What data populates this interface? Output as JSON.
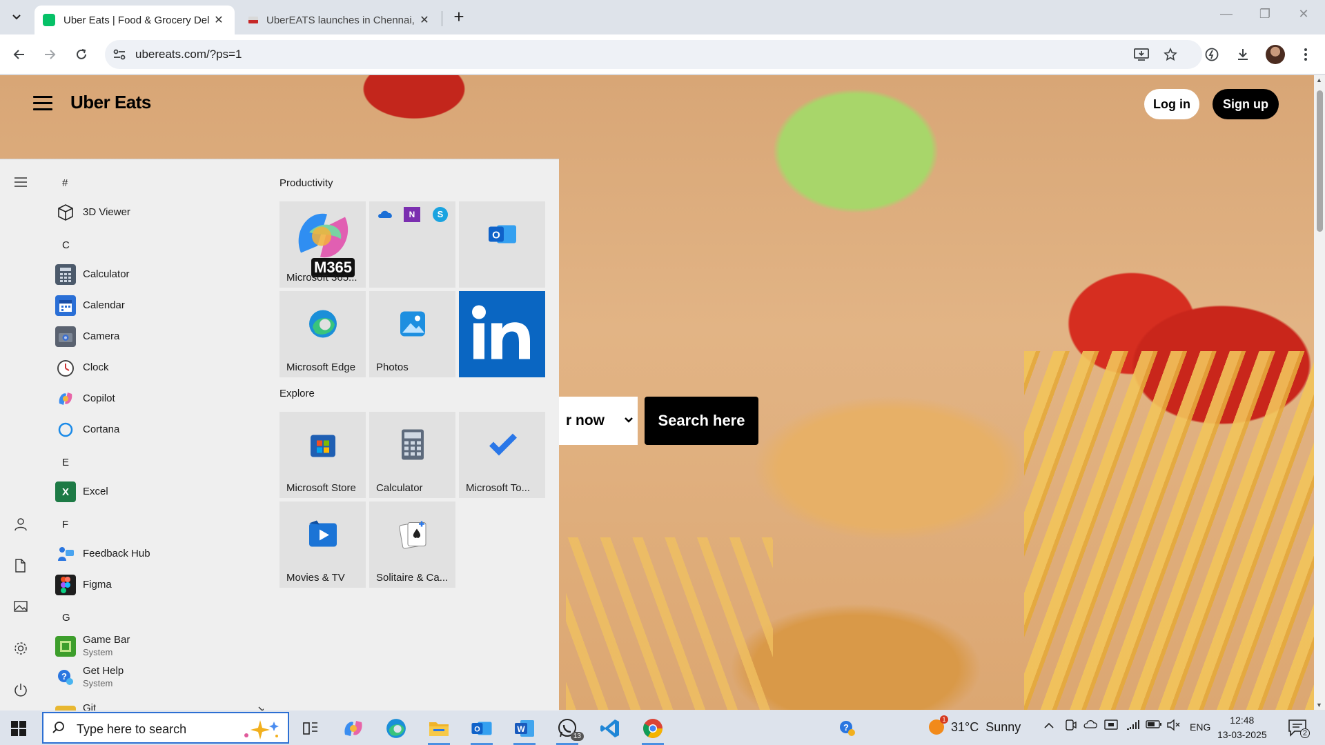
{
  "browser": {
    "tabs": [
      {
        "title": "Uber Eats | Food & Grocery Del",
        "active": true
      },
      {
        "title": "UberEATS launches in Chennai,",
        "active": false
      }
    ],
    "new_tab_label": "+",
    "url": "ubereats.com/?ps=1"
  },
  "site": {
    "logo": "Uber Eats",
    "login_label": "Log in",
    "signup_label": "Sign up",
    "deliver_label": "r now",
    "search_label": "Search here"
  },
  "start_menu": {
    "apps": [
      {
        "type": "letter",
        "text": "#"
      },
      {
        "type": "app",
        "name": "3D Viewer",
        "icon": "cube-icon"
      },
      {
        "type": "letter",
        "text": "C"
      },
      {
        "type": "app",
        "name": "Calculator",
        "icon": "calculator-icon"
      },
      {
        "type": "app",
        "name": "Calendar",
        "icon": "calendar-icon"
      },
      {
        "type": "app",
        "name": "Camera",
        "icon": "camera-icon"
      },
      {
        "type": "app",
        "name": "Clock",
        "icon": "clock-icon"
      },
      {
        "type": "app",
        "name": "Copilot",
        "icon": "copilot-icon"
      },
      {
        "type": "app",
        "name": "Cortana",
        "icon": "cortana-icon"
      },
      {
        "type": "letter",
        "text": "E"
      },
      {
        "type": "app",
        "name": "Excel",
        "icon": "excel-icon"
      },
      {
        "type": "letter",
        "text": "F"
      },
      {
        "type": "app",
        "name": "Feedback Hub",
        "icon": "feedback-hub-icon"
      },
      {
        "type": "app",
        "name": "Figma",
        "icon": "figma-icon"
      },
      {
        "type": "letter",
        "text": "G"
      },
      {
        "type": "app",
        "name": "Game Bar",
        "sub": "System",
        "icon": "game-bar-icon"
      },
      {
        "type": "app",
        "name": "Get Help",
        "sub": "System",
        "icon": "get-help-icon"
      },
      {
        "type": "app",
        "name": "Git",
        "icon": "folder-icon"
      }
    ],
    "groups": {
      "productivity": "Productivity",
      "explore": "Explore"
    },
    "tiles": {
      "m365": {
        "label": "Microsoft 365...",
        "badge": "M365"
      },
      "edge": "Microsoft Edge",
      "photos": "Photos",
      "store": "Microsoft Store",
      "calculator": "Calculator",
      "todo": "Microsoft To...",
      "movies": "Movies & TV",
      "solitaire": "Solitaire & Ca..."
    }
  },
  "taskbar": {
    "search_placeholder": "Type here to search",
    "whatsapp_badge": "13",
    "weather": "31°C  Sunny",
    "weather_badge": "1",
    "lang": "ENG",
    "time": "12:48",
    "date": "13-03-2025",
    "notif_count": "2"
  }
}
